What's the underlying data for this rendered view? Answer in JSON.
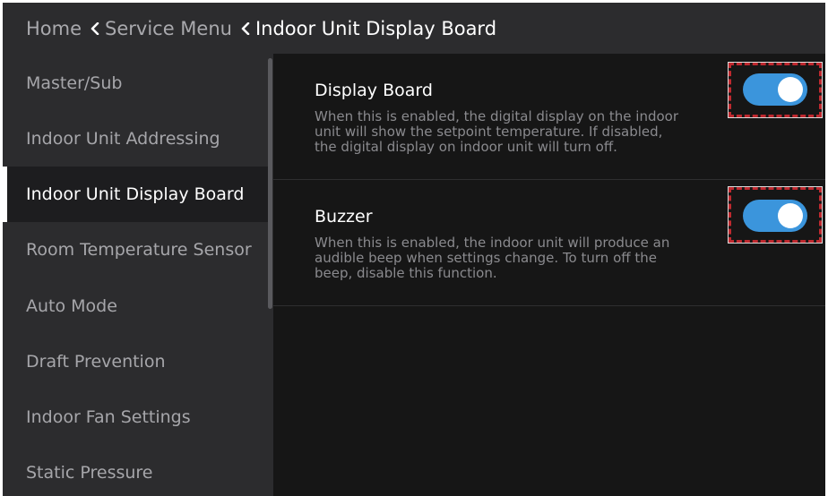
{
  "breadcrumb": {
    "home": "Home",
    "service_menu": "Service Menu",
    "current": "Indoor Unit Display Board"
  },
  "sidebar": {
    "items": [
      {
        "label": "Master/Sub"
      },
      {
        "label": "Indoor Unit Addressing"
      },
      {
        "label": "Indoor Unit Display Board",
        "active": true
      },
      {
        "label": "Room Temperature Sensor"
      },
      {
        "label": "Auto Mode"
      },
      {
        "label": "Draft Prevention"
      },
      {
        "label": "Indoor Fan Settings"
      },
      {
        "label": "Static Pressure"
      }
    ]
  },
  "settings": [
    {
      "title": "Display Board",
      "description_lines": [
        "When this is enabled, the digital display on the indoor",
        "unit will show the setpoint temperature. If disabled,",
        "the digital display on indoor unit will turn off."
      ],
      "enabled": true
    },
    {
      "title": "Buzzer",
      "description_lines": [
        "When this is enabled, the indoor unit will produce an",
        "audible beep when settings change. To turn off the",
        "beep, disable this function."
      ],
      "enabled": true
    }
  ],
  "colors": {
    "toggle_on": "#3b95dc",
    "highlight": "#c0292f",
    "header_bg": "#2c2c2e",
    "content_bg": "#161616"
  },
  "icons": [
    "chevron-left-icon"
  ]
}
